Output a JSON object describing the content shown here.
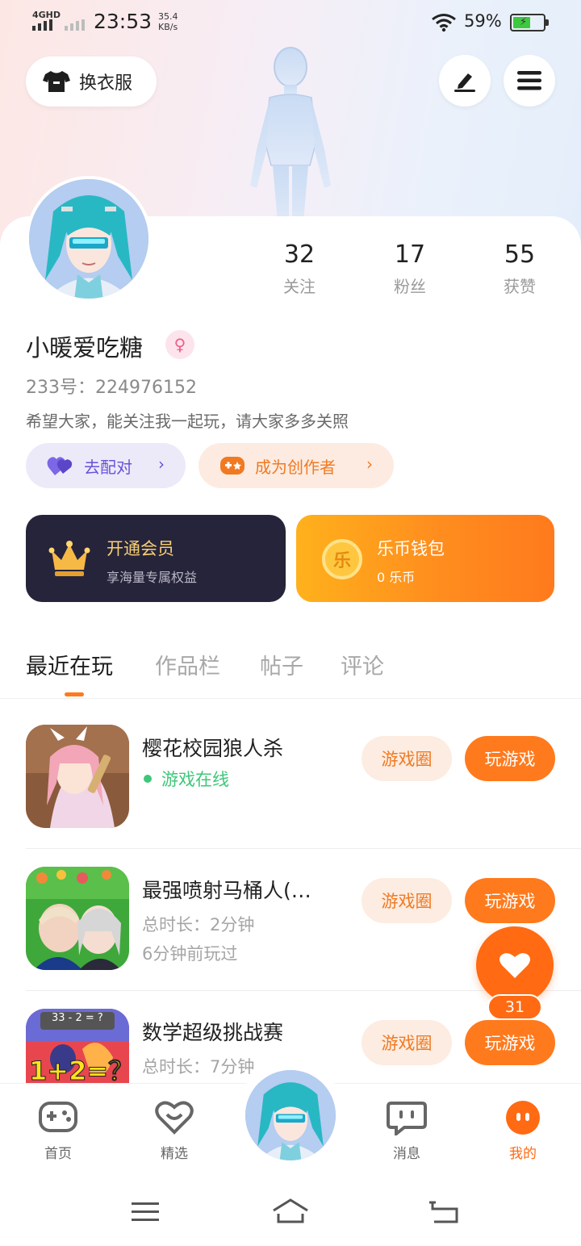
{
  "status_bar": {
    "network": "4GHD",
    "time": "23:53",
    "speed_value": "35.4",
    "speed_unit": "KB/s",
    "battery_percent": "59%",
    "battery_level": 0.59
  },
  "header": {
    "dress_label": "换衣服",
    "edit_icon": "edit-icon",
    "menu_icon": "menu-icon"
  },
  "profile": {
    "stats": [
      {
        "value": "32",
        "label": "关注"
      },
      {
        "value": "17",
        "label": "粉丝"
      },
      {
        "value": "55",
        "label": "获赞"
      }
    ],
    "username": "小暖爱吃糖",
    "gender_symbol": "♀",
    "uid": "233号：224976152",
    "bio": "希望大家，能关注我一起玩，请大家多多关照"
  },
  "actions": {
    "match_label": "去配对",
    "creator_label": "成为创作者"
  },
  "cards": {
    "vip": {
      "title": "开通会员",
      "subtitle": "享海量专属权益"
    },
    "wallet": {
      "title": "乐币钱包",
      "subtitle": "0 乐币",
      "coin_glyph": "乐"
    }
  },
  "tabs": [
    "最近在玩",
    "作品栏",
    "帖子",
    "评论"
  ],
  "games": [
    {
      "name": "樱花校园狼人杀",
      "status": "游戏在线",
      "circle_label": "游戏圈",
      "play_label": "玩游戏"
    },
    {
      "name": "最强喷射马桶人(…",
      "duration": "总时长：2分钟",
      "last_played": "6分钟前玩过",
      "circle_label": "游戏圈",
      "play_label": "玩游戏"
    },
    {
      "name": "数学超级挑战赛",
      "duration": "总时长：7分钟",
      "circle_label": "游戏圈",
      "play_label": "玩游戏",
      "thumb_text_top": "33 - 2 = ?",
      "thumb_text_big": "1+2=？"
    }
  ],
  "like": {
    "count": "31"
  },
  "bottom_nav": [
    {
      "label": "首页",
      "icon": "gamepad-icon"
    },
    {
      "label": "精选",
      "icon": "heart-smile-icon"
    },
    {
      "label": "消息",
      "icon": "chat-icon"
    },
    {
      "label": "我的",
      "icon": "me-icon",
      "active": true
    }
  ],
  "colors": {
    "accent": "#ff7a1d",
    "vip_bg": "#26243a",
    "match_purple": "#6754d8",
    "online_green": "#3ec77a"
  }
}
